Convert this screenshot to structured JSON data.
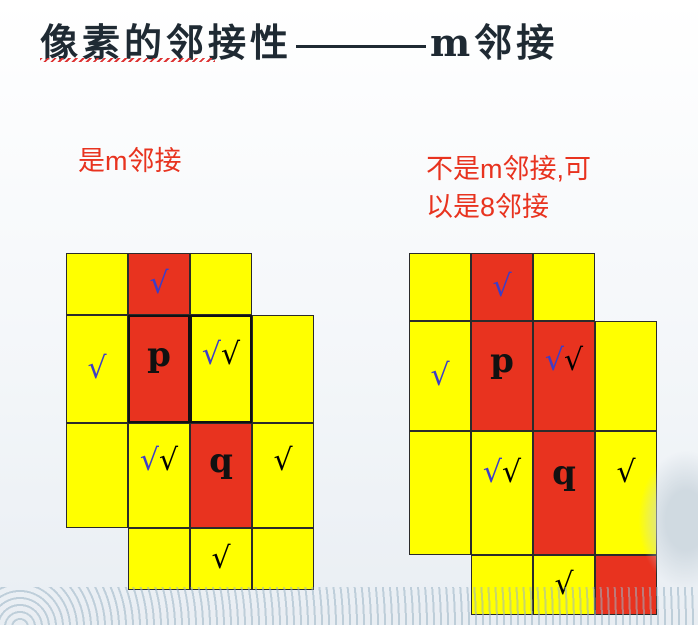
{
  "title": {
    "left": "像素的邻接性",
    "right": "m邻接"
  },
  "left_caption": "是m邻接",
  "right_caption_line1": "不是m邻接,可",
  "right_caption_line2": "以是8邻接",
  "check": "√",
  "double_check": "√√",
  "label_p": "p",
  "label_q": "q",
  "colors": {
    "yellow": "#ffff00",
    "red": "#e8331f",
    "caption": "#e8331f",
    "blue_mark": "#3d3dc7"
  }
}
